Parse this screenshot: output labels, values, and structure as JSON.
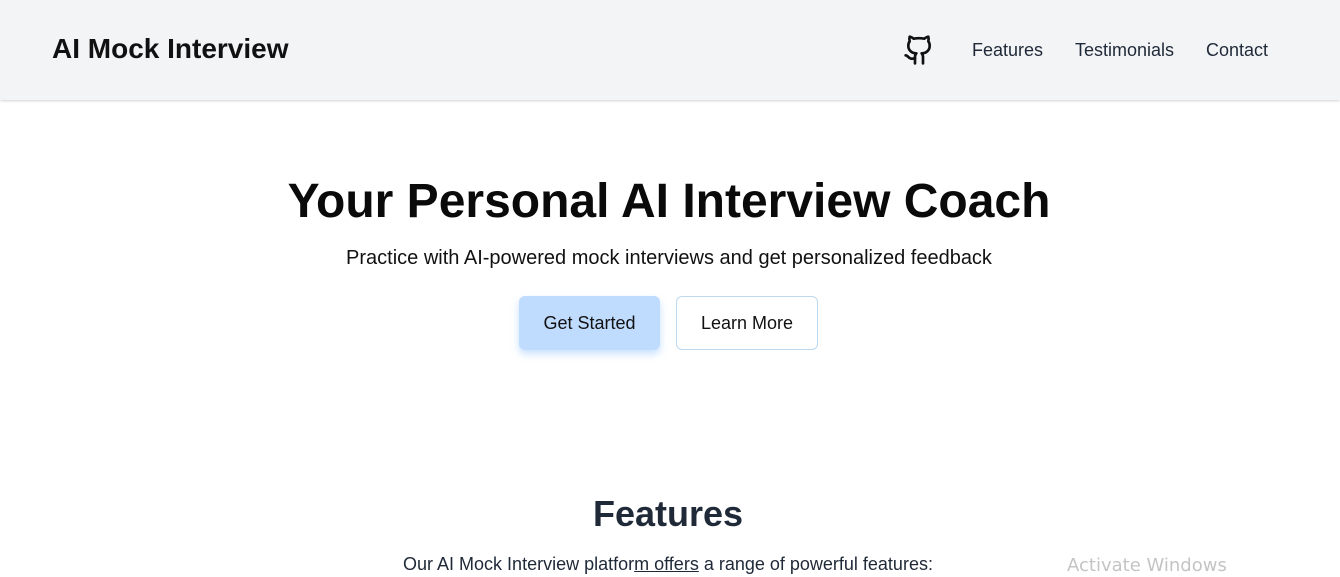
{
  "header": {
    "brand": "AI Mock Interview",
    "github_icon": "github-icon",
    "nav": {
      "features": "Features",
      "testimonials": "Testimonials",
      "contact": "Contact"
    }
  },
  "hero": {
    "title": "Your Personal AI Interview Coach",
    "subtitle": "Practice with AI-powered mock interviews and get personalized feedback",
    "primary_button": "Get Started",
    "secondary_button": "Learn More"
  },
  "features": {
    "title": "Features",
    "desc_part1": "Our AI Mock Interview platfor",
    "desc_part2": "m offers",
    "desc_part3": " a range of powerful features:"
  },
  "watermark": "Activate Windows",
  "colors": {
    "header_bg": "#f3f4f6",
    "primary_button_bg": "#bfdbfe",
    "secondary_button_border": "#bcd9ef"
  }
}
